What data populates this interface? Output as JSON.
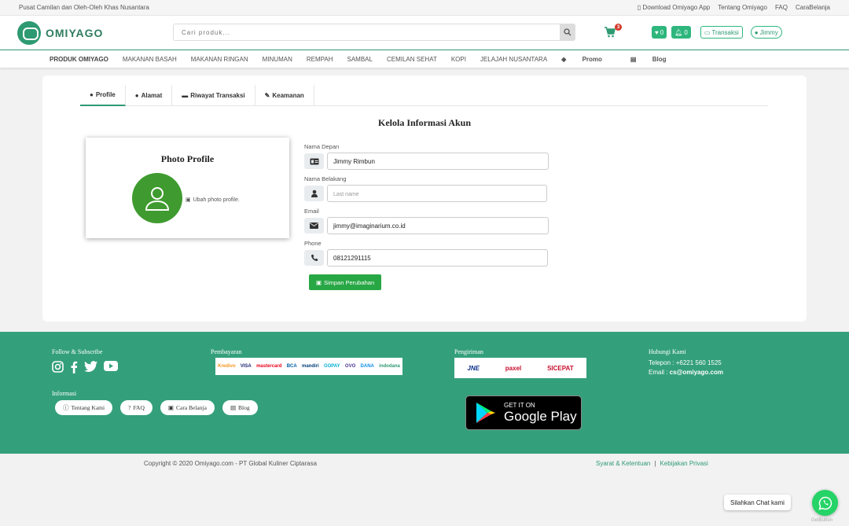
{
  "topbar": {
    "tagline": "Pusat Camilan dan Oleh-Oleh Khas Nusantara",
    "links": [
      "Download Omiyago App",
      "Tentang Omiyago",
      "FAQ",
      "CaraBelanja"
    ]
  },
  "header": {
    "logo_text": "OMIYAGO",
    "search_placeholder": "Cari produk...",
    "cart_count": "3",
    "wishlist_count": "0",
    "notif_count": "0",
    "transaksi_label": "Transaksi",
    "user_label": "Jimmy"
  },
  "nav": {
    "items": [
      "PRODUK OMIYAGO",
      "MAKANAN BASAH",
      "MAKANAN RINGAN",
      "MINUMAN",
      "REMPAH",
      "SAMBAL",
      "CEMILAN SEHAT",
      "KOPI",
      "JELAJAH NUSANTARA",
      "Promo",
      "Blog"
    ]
  },
  "tabs": [
    "Profile",
    "Alamat",
    "Riwayat Transaksi",
    "Keamanan"
  ],
  "main": {
    "title": "Kelola Informasi Akun",
    "photo_title": "Photo Profile",
    "photo_link": "Ubah photo profile.",
    "fields": {
      "first_name": {
        "label": "Nama Depan",
        "value": "Jimmy Rimbun"
      },
      "last_name": {
        "label": "Nama Belakang",
        "placeholder": "Last name"
      },
      "email": {
        "label": "Email",
        "value": "jimmy@imaginarium.co.id"
      },
      "phone": {
        "label": "Phone",
        "value": "08121291115"
      }
    },
    "save_label": "Simpan Perubahan"
  },
  "footer": {
    "follow_title": "Follow & Subscribe",
    "payment_title": "Pembayaran",
    "payment_logos": [
      "Kredivo",
      "VISA",
      "mastercard",
      "BCA",
      "mandiri",
      "GOPAY",
      "OVO",
      "DANA",
      "indodana"
    ],
    "shipping_title": "Pengiriman",
    "shipping_logos": [
      "JNE",
      "paxel",
      "SICEPAT"
    ],
    "contact_title": "Hubungi Kami",
    "phone": "Telepon : +6221 560 1525",
    "email_prefix": "Email : ",
    "email": "cs@omiyago.com",
    "info_title": "Informasi",
    "info_buttons": [
      "Tentang Kami",
      "FAQ",
      "Cara Belanja",
      "Blog"
    ],
    "gplay_small": "GET IT ON",
    "gplay_big": "Google Play"
  },
  "bottom": {
    "copyright": "Copyright © 2020 Omiyago.com - PT Global Kuliner Ciptarasa",
    "terms": "Syarat & Ketentuan",
    "separator": "|",
    "privacy": "Kebijakan Privasi",
    "chat_label": "Silahkan Chat kami",
    "getbutton": "GetButton"
  },
  "colors": {
    "brand": "#34a07b",
    "accent": "#2eb67d",
    "save": "#28a745",
    "avatar": "#3f9b2f",
    "badge": "#d43a2b"
  }
}
